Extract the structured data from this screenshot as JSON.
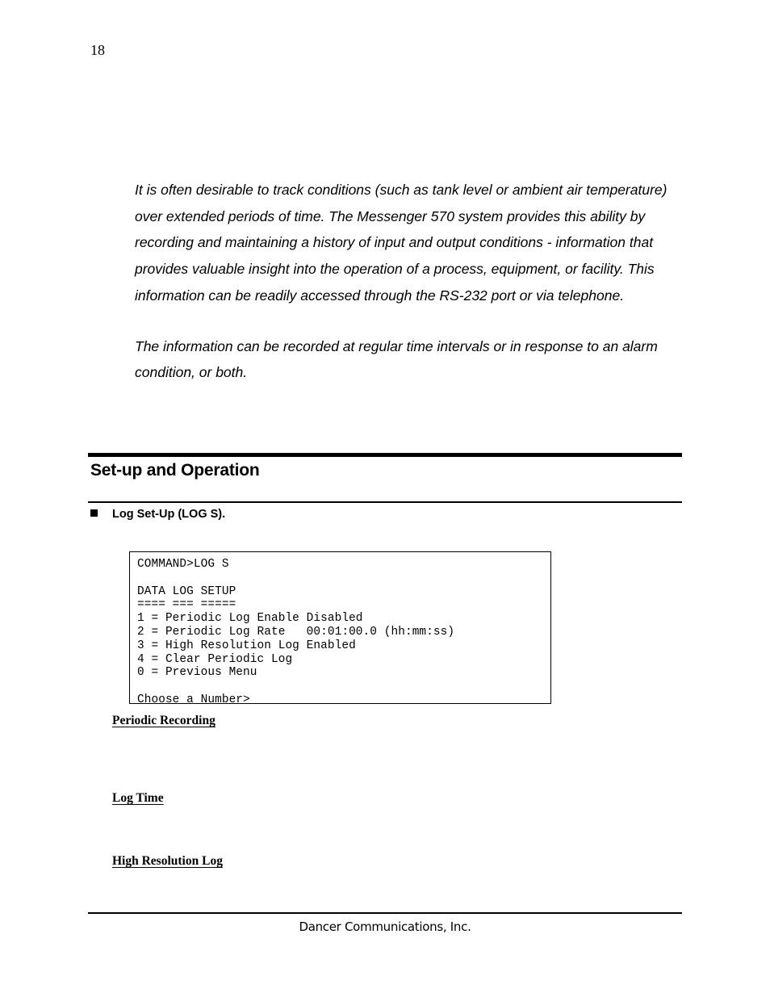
{
  "page": {
    "number": "18"
  },
  "body": {
    "paragraphs": [
      "It is often desirable to track conditions (such as tank level or ambient air temperature) over extended periods of time. The Messenger 570 system provides this ability by recording and maintaining a history of input and output conditions - information that provides valuable insight into the operation of a process, equipment, or facility. This information can be readily accessed through the RS-232 port or via telephone.",
      "The information can be recorded at regular time intervals or in response to an alarm condition, or both."
    ]
  },
  "section": {
    "heading": "Set-up and Operation",
    "bullet": {
      "glyph": "filled-square",
      "label": "Log Set-Up (LOG S)."
    }
  },
  "terminal": {
    "lines": [
      "COMMAND>LOG S",
      "",
      "DATA LOG SETUP",
      "==== === =====",
      "1 = Periodic Log Enable Disabled",
      "2 = Periodic Log Rate   00:01:00.0 (hh:mm:ss)",
      "3 = High Resolution Log Enabled",
      "4 = Clear Periodic Log",
      "0 = Previous Menu",
      "",
      "Choose a Number>"
    ],
    "text": "COMMAND>LOG S\n\nDATA LOG SETUP\n==== === =====\n1 = Periodic Log Enable Disabled\n2 = Periodic Log Rate   00:01:00.0 (hh:mm:ss)\n3 = High Resolution Log Enabled\n4 = Clear Periodic Log\n0 = Previous Menu\n\nChoose a Number>"
  },
  "subheadings": [
    "Periodic Recording",
    "Log Time",
    "High Resolution Log"
  ],
  "footer": {
    "text": "Dancer Communications, Inc."
  }
}
